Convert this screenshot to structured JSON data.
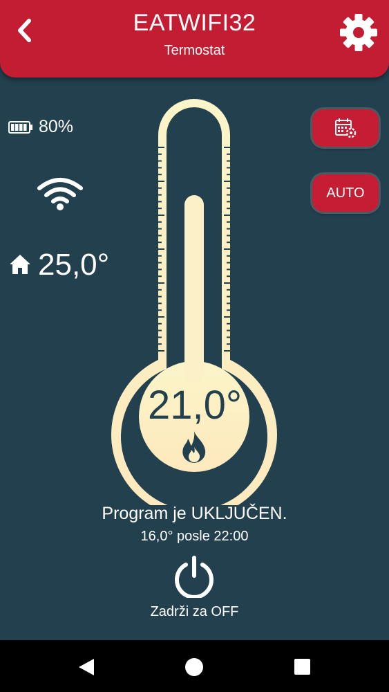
{
  "header": {
    "title": "EATWIFI32",
    "subtitle": "Termostat",
    "back_icon": "chevron-left-icon",
    "settings_icon": "gear-icon"
  },
  "status": {
    "battery_percent": "80%",
    "battery_level": 0.8,
    "wifi_icon": "wifi-icon",
    "home_icon": "home-icon",
    "room_temperature": "25,0°"
  },
  "buttons": {
    "schedule_icon": "calendar-settings-icon",
    "mode_label": "AUTO"
  },
  "thermostat": {
    "set_temperature": "21,0°",
    "heating_icon": "flame-icon"
  },
  "program": {
    "status_text": "Program je UKLJUČEN.",
    "next_change": "16,0° posle 22:00",
    "power_icon": "power-icon",
    "hold_hint": "Zadrži za OFF"
  },
  "colors": {
    "background": "#23404f",
    "header": "#c31d33",
    "thermometer": "#fbf2c4"
  }
}
